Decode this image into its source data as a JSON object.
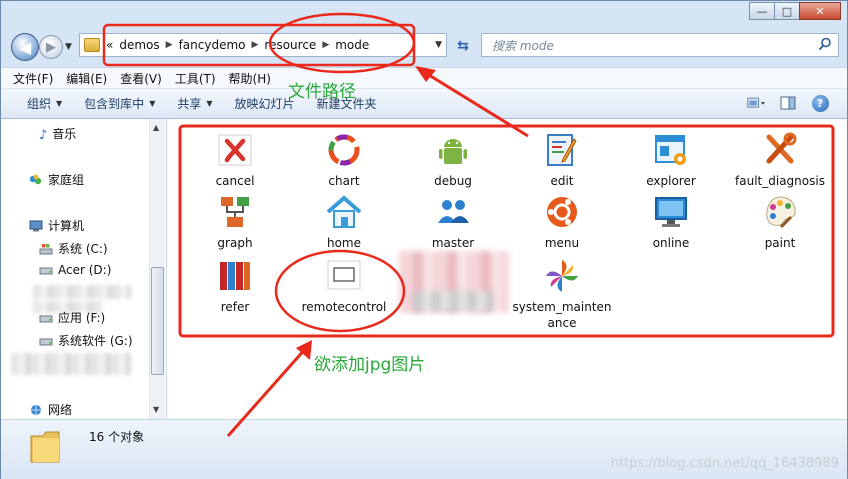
{
  "window": {
    "caption_buttons": {
      "minimize": "—",
      "maximize": "□",
      "close": "✕"
    }
  },
  "address_bar": {
    "overflow_indicator": "«",
    "breadcrumbs": [
      "demos",
      "fancydemo",
      "resource",
      "mode"
    ]
  },
  "search": {
    "placeholder": "搜索 mode"
  },
  "menubar": [
    "文件(F)",
    "编辑(E)",
    "查看(V)",
    "工具(T)",
    "帮助(H)"
  ],
  "toolbar": {
    "organize": "组织",
    "include_in_library": "包含到库中",
    "share": "共享",
    "slideshow": "放映幻灯片",
    "new_folder": "新建文件夹",
    "help": "?"
  },
  "sidebar": {
    "music": "音乐",
    "homegroup": "家庭组",
    "computer": "计算机",
    "drive_c": "系统 (C:)",
    "drive_d": "Acer (D:)",
    "drive_f": "应用 (F:)",
    "drive_g": "系统软件 (G:)",
    "network": "网络"
  },
  "files": [
    {
      "label": "cancel",
      "icon": "cancel-icon",
      "color": "#d9342b"
    },
    {
      "label": "chart",
      "icon": "chart-icon",
      "color": "#e94e1b"
    },
    {
      "label": "debug",
      "icon": "android-debug-icon",
      "color": "#7cb342"
    },
    {
      "label": "edit",
      "icon": "edit-icon",
      "color": "#3d7cc9"
    },
    {
      "label": "explorer",
      "icon": "explorer-icon",
      "color": "#2c8fd6"
    },
    {
      "label": "fault_diagnosis",
      "icon": "tools-icon",
      "color": "#e06820"
    },
    {
      "label": "graph",
      "icon": "graph-icon",
      "color": "#e0672a"
    },
    {
      "label": "home",
      "icon": "home-icon",
      "color": "#3a9bd9"
    },
    {
      "label": "master",
      "icon": "users-icon",
      "color": "#2f7fd0"
    },
    {
      "label": "menu",
      "icon": "ubuntu-menu-icon",
      "color": "#e55a1b"
    },
    {
      "label": "online",
      "icon": "monitor-icon",
      "color": "#2a8bd8"
    },
    {
      "label": "paint",
      "icon": "paint-icon",
      "color": "#d23a8c"
    },
    {
      "label": "refer",
      "icon": "books-icon",
      "color": "#c62828"
    },
    {
      "label": "remotecontrol",
      "icon": "blank-window-icon",
      "color": "#444444"
    },
    {
      "label": "system_maintenance",
      "icon": "pinwheel-icon",
      "color": "#7e57c2"
    }
  ],
  "status": {
    "count_text": "16 个对象"
  },
  "annotations": {
    "file_path": "文件路径",
    "want_add_jpg": "欲添加jpg图片",
    "color": "#e8291c",
    "text_color": "#2aa83a"
  },
  "watermark": "https://blog.csdn.net/qq_16438989"
}
